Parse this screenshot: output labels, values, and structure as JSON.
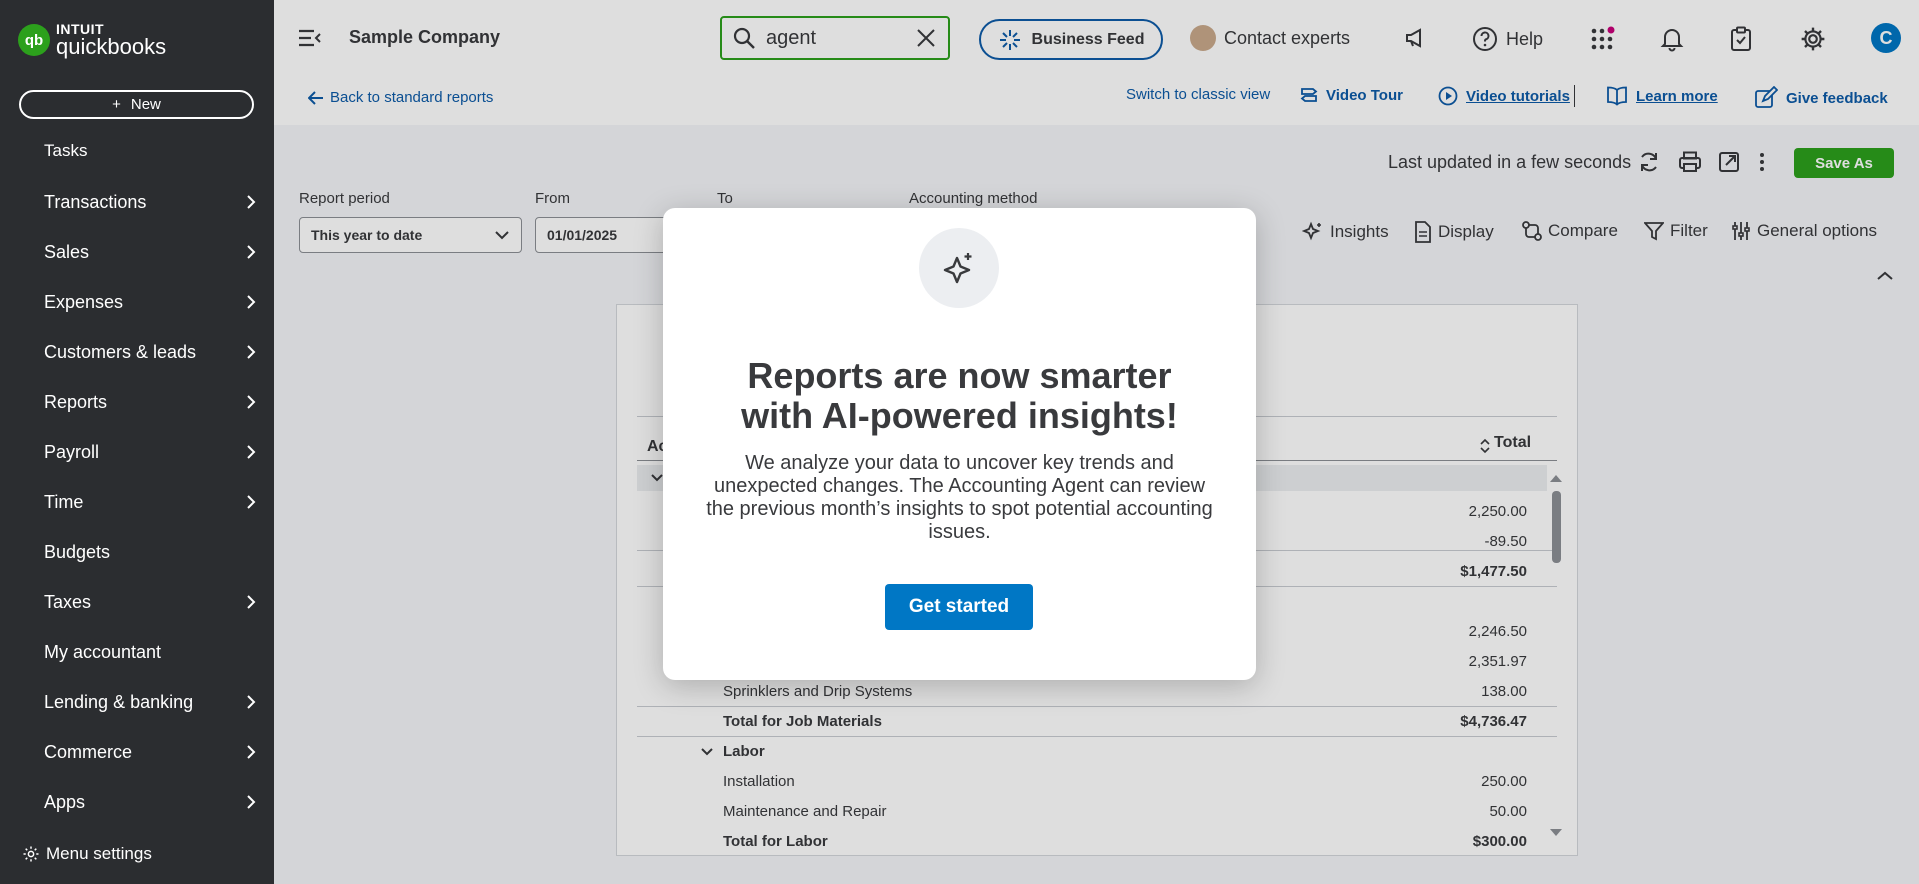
{
  "sidebar": {
    "brand_top": "INTUIT",
    "brand_name": "quickbooks",
    "new_label": "New",
    "tasks_label": "Tasks",
    "items": [
      {
        "label": "Transactions",
        "chevron": true
      },
      {
        "label": "Sales",
        "chevron": true
      },
      {
        "label": "Expenses",
        "chevron": true
      },
      {
        "label": "Customers & leads",
        "chevron": true
      },
      {
        "label": "Reports",
        "chevron": true
      },
      {
        "label": "Payroll",
        "chevron": true
      },
      {
        "label": "Time",
        "chevron": true
      },
      {
        "label": "Budgets",
        "chevron": false
      },
      {
        "label": "Taxes",
        "chevron": true
      },
      {
        "label": "My accountant",
        "chevron": false
      },
      {
        "label": "Lending & banking",
        "chevron": true
      },
      {
        "label": "Commerce",
        "chevron": true
      },
      {
        "label": "Apps",
        "chevron": true
      }
    ],
    "menu_settings": "Menu settings"
  },
  "header": {
    "company": "Sample Company",
    "search_value": "agent",
    "business_feed": "Business Feed",
    "contact_experts": "Contact experts",
    "help": "Help",
    "user_initial": "C"
  },
  "subbar": {
    "back": "Back to standard reports",
    "switch_classic": "Switch to classic view",
    "video_tour": "Video Tour",
    "video_tutorials": "Video tutorials",
    "learn_more": "Learn more",
    "give_feedback": "Give feedback"
  },
  "report": {
    "last_updated": "Last updated in a few seconds",
    "save_as": "Save As",
    "report_period_label": "Report period",
    "report_period_value": "This year to date",
    "from_label": "From",
    "from_value": "01/01/2025",
    "to_label": "To",
    "accounting_method_label": "Accounting method",
    "toolbar": {
      "insights": "Insights",
      "display": "Display",
      "compare": "Compare",
      "filter": "Filter",
      "general_options": "General options"
    },
    "col_account": "Ac",
    "col_total": "Total",
    "rows": [
      {
        "name": "",
        "amount": "2,250.00",
        "bold": false
      },
      {
        "name": "",
        "amount": "-89.50",
        "bold": false
      },
      {
        "name": "",
        "amount": "$1,477.50",
        "bold": true
      },
      {
        "name": "",
        "amount": "2,246.50",
        "bold": false
      },
      {
        "name": "",
        "amount": "2,351.97",
        "bold": false
      },
      {
        "name": "Sprinklers and Drip Systems",
        "amount": "138.00",
        "bold": false
      },
      {
        "name": "Total for Job Materials",
        "amount": "$4,736.47",
        "bold": true
      },
      {
        "name": "Labor",
        "amount": "",
        "bold": true
      },
      {
        "name": "Installation",
        "amount": "250.00",
        "bold": false
      },
      {
        "name": "Maintenance and Repair",
        "amount": "50.00",
        "bold": false
      },
      {
        "name": "Total for Labor",
        "amount": "$300.00",
        "bold": true
      }
    ]
  },
  "modal": {
    "title_line1": "Reports are now smarter",
    "title_line2": "with AI-powered insights!",
    "body": "We analyze your data to uncover key trends and unexpected changes. The Accounting Agent can review the previous month’s insights to spot potential accounting issues.",
    "cta": "Get started"
  }
}
